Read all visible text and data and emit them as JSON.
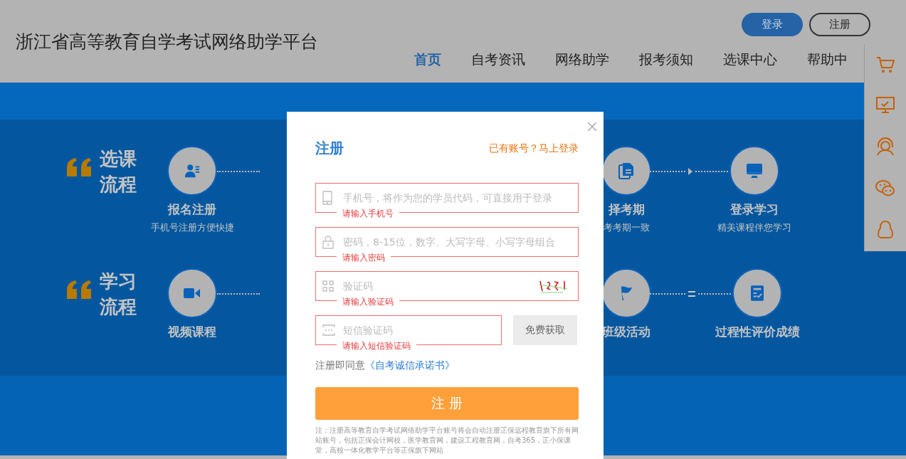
{
  "header": {
    "title": "浙江省高等教育自学考试网络助学平台",
    "auth_buttons": [
      {
        "label": "登录",
        "kind": "primary"
      },
      {
        "label": "注册",
        "kind": "outline"
      }
    ],
    "nav": [
      {
        "label": "首页",
        "selected": true
      },
      {
        "label": "自考资讯",
        "selected": false
      },
      {
        "label": "网络助学",
        "selected": false
      },
      {
        "label": "报考须知",
        "selected": false
      },
      {
        "label": "选课中心",
        "selected": false
      },
      {
        "label": "帮助中",
        "selected": false
      }
    ]
  },
  "process": [
    {
      "title": [
        "选课",
        "流程"
      ],
      "kind": "arrow",
      "steps": [
        {
          "title": "报名注册",
          "subtitle": "手机号注册方便快捷",
          "kind": "person"
        },
        {
          "title": "择考期",
          "subtitle": "考考期一致",
          "kind": "document"
        },
        {
          "title": "登录学习",
          "subtitle": "精美课程伴您学习",
          "kind": "monitor"
        }
      ]
    },
    {
      "title": [
        "学习",
        "流程"
      ],
      "kind": "equals",
      "steps": [
        {
          "title": "视频课程",
          "kind": "video"
        },
        {
          "title": "班级活动",
          "kind": "flag"
        },
        {
          "title": "过程性评价成绩",
          "kind": "score"
        }
      ]
    }
  ],
  "modal": {
    "title": "注册",
    "login_prompt": "已有账号？马上登录",
    "fields": [
      {
        "kind": "phone",
        "placeholder": "手机号，将作为您的学员代码，可直接用于登录",
        "invalid": true,
        "error": "请输入手机号"
      },
      {
        "kind": "password",
        "placeholder": "密码，8-15位，数字、大写字母、小写字母组合",
        "invalid": true,
        "error": "请输入密码"
      },
      {
        "kind": "captcha",
        "placeholder": "验证码",
        "invalid": true,
        "error": "请输入验证码"
      },
      {
        "kind": "sms",
        "placeholder": "短信验证码",
        "invalid": true,
        "error": "请输入短信验证码",
        "button": "免费获取"
      }
    ],
    "agreement": {
      "text": "注册即同意",
      "link": "《自考诚信承诺书》"
    },
    "submit": "注 册",
    "note": "注：注册高等教育自学考试网络助学平台账号将会自动注册正保远程教育旗下所有网站账号，包括正保会计网校，医学教育网，建设工程教育网，自考365，正小保课堂，高校一体化教学平台等正保旗下网站"
  }
}
